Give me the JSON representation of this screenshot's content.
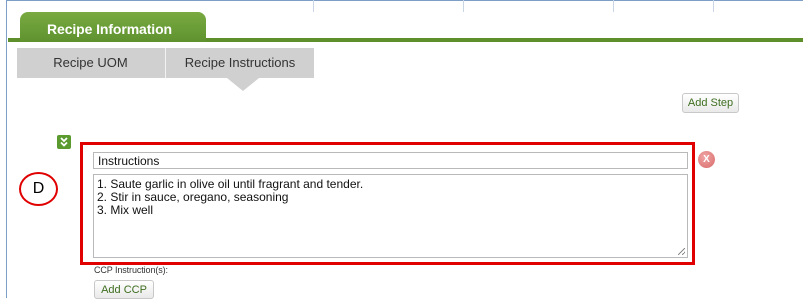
{
  "main_tab": {
    "label": "Recipe Information"
  },
  "sub_tabs": [
    {
      "label": "Recipe UOM",
      "active": false
    },
    {
      "label": "Recipe Instructions",
      "active": true
    }
  ],
  "step_actions": {
    "add_step_label": "Add Step"
  },
  "step": {
    "collapse_icon": "double-chevron-down-icon",
    "title_value": "Instructions",
    "instructions_lines": [
      "1. Saute garlic in olive oil until fragrant and tender.",
      "2. Stir in sauce, oregano, seasoning",
      "3. Mix well"
    ],
    "remove_icon": "close-circle-icon",
    "remove_glyph": "X"
  },
  "callout": {
    "label": "D"
  },
  "ccp": {
    "label": "CCP Instruction(s):",
    "add_label": "Add CCP"
  },
  "colors": {
    "brand_green": "#5e8f2c",
    "highlight_red": "#e00000",
    "subtab_gray": "#d0d0d0"
  }
}
